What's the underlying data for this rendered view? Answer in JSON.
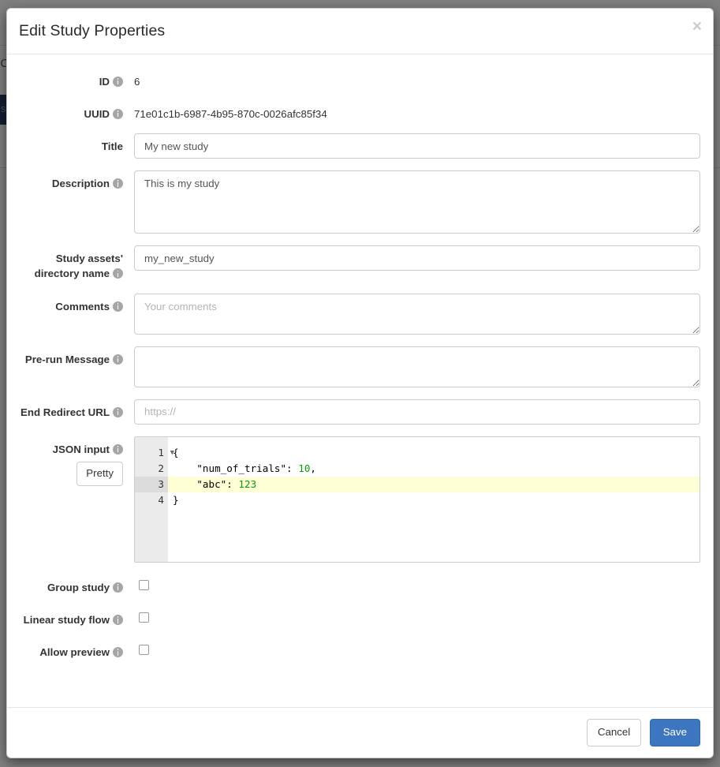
{
  "background": {
    "fragment_text": "IC",
    "nav_label": "s"
  },
  "modal": {
    "title": "Edit Study Properties",
    "close_label": "×",
    "close_icon": "close-icon",
    "info_icon": "info-circle-icon"
  },
  "fields": {
    "id": {
      "label": "ID",
      "has_info": true,
      "value": "6"
    },
    "uuid": {
      "label": "UUID",
      "has_info": true,
      "value": "71e01c1b-6987-4b95-870c-0026afc85f34"
    },
    "title": {
      "label": "Title",
      "has_info": false,
      "value": "My new study",
      "placeholder": ""
    },
    "description": {
      "label": "Description",
      "has_info": true,
      "value": "This is my study",
      "placeholder": ""
    },
    "assets_dir": {
      "label": "Study assets' directory name",
      "has_info": true,
      "value": "my_new_study",
      "placeholder": ""
    },
    "comments": {
      "label": "Comments",
      "has_info": true,
      "value": "",
      "placeholder": "Your comments"
    },
    "prerun_message": {
      "label": "Pre-run Message",
      "has_info": true,
      "value": "",
      "placeholder": ""
    },
    "end_redirect_url": {
      "label": "End Redirect URL",
      "has_info": true,
      "value": "",
      "placeholder": "https://"
    },
    "json_input": {
      "label": "JSON input",
      "has_info": true,
      "pretty_button": "Pretty",
      "active_line": 3,
      "lines": [
        {
          "number": "1",
          "fold": true,
          "tokens": [
            {
              "t": "{",
              "k": "punc"
            }
          ]
        },
        {
          "number": "2",
          "fold": false,
          "tokens": [
            {
              "t": "    \"num_of_trials\": ",
              "k": "str"
            },
            {
              "t": "10",
              "k": "num"
            },
            {
              "t": ",",
              "k": "punc"
            }
          ]
        },
        {
          "number": "3",
          "fold": false,
          "tokens": [
            {
              "t": "    \"abc\": ",
              "k": "str"
            },
            {
              "t": "123",
              "k": "num"
            }
          ]
        },
        {
          "number": "4",
          "fold": false,
          "tokens": [
            {
              "t": "}",
              "k": "punc"
            }
          ]
        }
      ]
    },
    "group_study": {
      "label": "Group study",
      "has_info": true,
      "checked": false
    },
    "linear_study_flow": {
      "label": "Linear study flow",
      "has_info": true,
      "checked": false
    },
    "allow_preview": {
      "label": "Allow preview",
      "has_info": true,
      "checked": false
    }
  },
  "footer": {
    "cancel_label": "Cancel",
    "save_label": "Save"
  },
  "colors": {
    "primary": "#3c76c0",
    "json_number": "#0b9b0b",
    "active_line_bg": "#feffd5",
    "gutter_bg": "#ebebeb",
    "backdrop": "#000000"
  }
}
